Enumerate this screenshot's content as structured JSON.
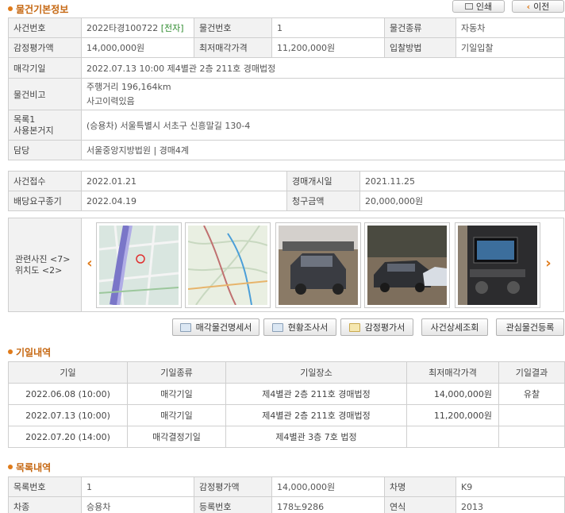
{
  "sections": {
    "basic_info": "물건기본정보",
    "auction_dates": "기일내역",
    "item_list": "목록내역"
  },
  "top_buttons": {
    "print": "인쇄",
    "back": "이전"
  },
  "basic": {
    "case_no_label": "사건번호",
    "case_no": "2022타경100722",
    "case_no_tag": "[전자]",
    "item_no_label": "물건번호",
    "item_no": "1",
    "item_type_label": "물건종류",
    "item_type": "자동차",
    "appraisal_label": "감정평가액",
    "appraisal": "14,000,000원",
    "min_price_label": "최저매각가격",
    "min_price": "11,200,000원",
    "bid_method_label": "입찰방법",
    "bid_method": "기일입찰",
    "sale_date_label": "매각기일",
    "sale_date": "2022.07.13 10:00 제4별관 2층 211호 경매법정",
    "note_label": "물건비고",
    "note_line1": "주행거리 196,164km",
    "note_line2": "사고이력있음",
    "location_label_1": "목록1",
    "location_label_2": "사용본거지",
    "location": "(승용차) 서울특별시 서초구 신흥말길 130-4",
    "charge_label": "담당",
    "charge": "서울중앙지방법원 | 경매4계"
  },
  "case": {
    "received_label": "사건접수",
    "received": "2022.01.21",
    "start_label": "경매개시일",
    "start": "2021.11.25",
    "dividend_label": "배당요구종기",
    "dividend": "2022.04.19",
    "claim_label": "청구금액",
    "claim": "20,000,000원"
  },
  "photos": {
    "label_1": "관련사진 <7>",
    "label_2": "위치도 <2>"
  },
  "actions": {
    "spec": "매각물건명세서",
    "survey": "현황조사서",
    "appraisal": "감정평가서",
    "case_detail": "사건상세조회",
    "interest": "관심물건등록"
  },
  "schedule": {
    "headers": [
      "기일",
      "기일종류",
      "기일장소",
      "최저매각가격",
      "기일결과"
    ],
    "rows": [
      [
        "2022.06.08 (10:00)",
        "매각기일",
        "제4별관 2층 211호 경매법정",
        "14,000,000원",
        "유찰"
      ],
      [
        "2022.07.13 (10:00)",
        "매각기일",
        "제4별관 2층 211호 경매법정",
        "11,200,000원",
        ""
      ],
      [
        "2022.07.20 (14:00)",
        "매각결정기일",
        "제4별관 3층 7호 법정",
        "",
        ""
      ]
    ]
  },
  "items": {
    "list_no_label": "목록번호",
    "list_no": "1",
    "appraisal_label": "감정평가액",
    "appraisal": "14,000,000원",
    "car_name_label": "차명",
    "car_name": "K9",
    "car_type_label": "차종",
    "car_type": "승용차",
    "reg_no_label": "등록번호",
    "reg_no": "178노9286",
    "year_label": "연식",
    "year": "2013"
  }
}
